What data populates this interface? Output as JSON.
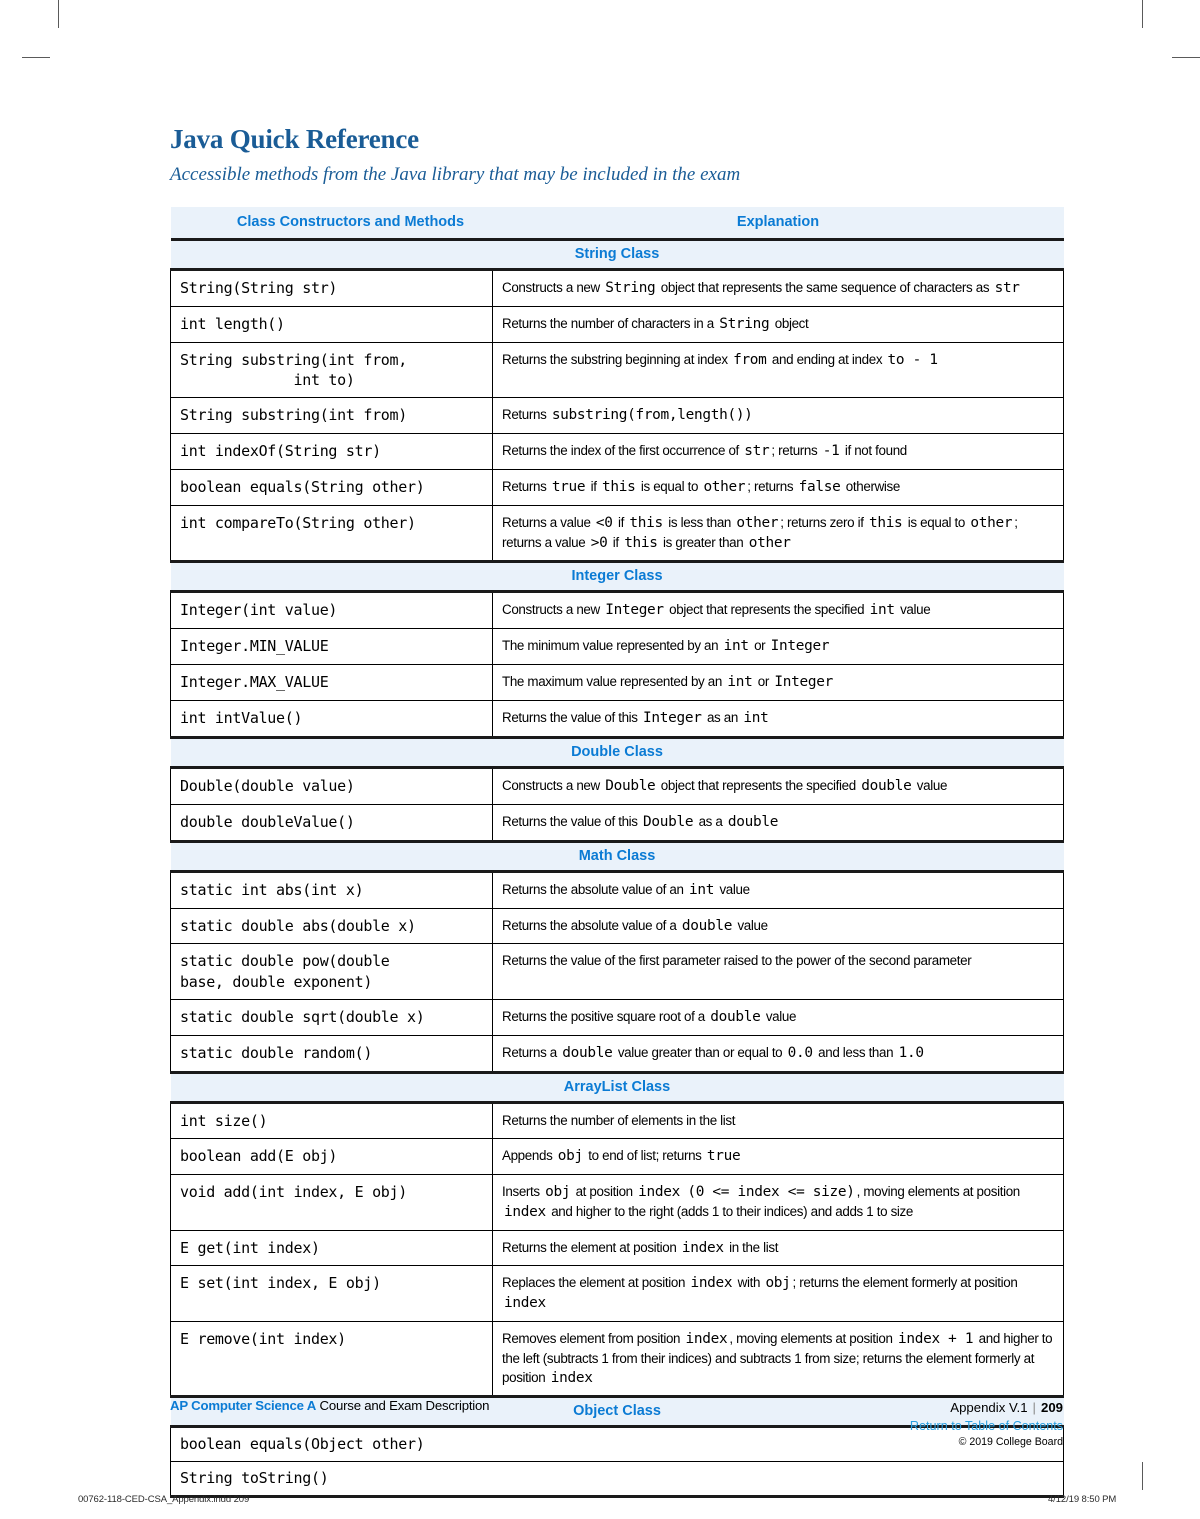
{
  "header": {
    "title": "Java Quick Reference",
    "subtitle": "Accessible methods from the Java library that may be included in the exam"
  },
  "table": {
    "columns": {
      "signature": "Class Constructors and Methods",
      "explanation": "Explanation"
    },
    "sections": [
      {
        "name": "String Class",
        "rows": [
          {
            "signature": "String(String str)",
            "explanation_parts": [
              {
                "t": "Constructs a new ",
                "code": false
              },
              {
                "t": "String",
                "code": true
              },
              {
                "t": " object that represents the same sequence of characters as ",
                "code": false
              },
              {
                "t": "str",
                "code": true
              }
            ]
          },
          {
            "signature": "int length()",
            "explanation_parts": [
              {
                "t": "Returns the number of characters in a ",
                "code": false
              },
              {
                "t": "String",
                "code": true
              },
              {
                "t": " object",
                "code": false
              }
            ]
          },
          {
            "signature": "String substring(int from,\n             int to)",
            "explanation_parts": [
              {
                "t": "Returns the substring beginning at index ",
                "code": false
              },
              {
                "t": "from",
                "code": true
              },
              {
                "t": " and ending at index ",
                "code": false
              },
              {
                "t": "to - 1",
                "code": true
              }
            ]
          },
          {
            "signature": "String substring(int from)",
            "explanation_parts": [
              {
                "t": "Returns ",
                "code": false
              },
              {
                "t": "substring(from,length())",
                "code": true
              }
            ]
          },
          {
            "signature": "int indexOf(String str)",
            "explanation_parts": [
              {
                "t": "Returns the index of the first occurrence of ",
                "code": false
              },
              {
                "t": "str",
                "code": true
              },
              {
                "t": "; returns ",
                "code": false
              },
              {
                "t": "-1",
                "code": true
              },
              {
                "t": " if not found",
                "code": false
              }
            ]
          },
          {
            "signature": "boolean equals(String other)",
            "explanation_parts": [
              {
                "t": "Returns ",
                "code": false
              },
              {
                "t": "true",
                "code": true
              },
              {
                "t": " if ",
                "code": false
              },
              {
                "t": "this",
                "code": true
              },
              {
                "t": " is equal to ",
                "code": false
              },
              {
                "t": "other",
                "code": true
              },
              {
                "t": "; returns ",
                "code": false
              },
              {
                "t": "false",
                "code": true
              },
              {
                "t": " otherwise",
                "code": false
              }
            ]
          },
          {
            "signature": "int compareTo(String other)",
            "explanation_parts": [
              {
                "t": "Returns a value ",
                "code": false
              },
              {
                "t": "<0",
                "code": true
              },
              {
                "t": " if ",
                "code": false
              },
              {
                "t": "this",
                "code": true
              },
              {
                "t": " is less than ",
                "code": false
              },
              {
                "t": "other",
                "code": true
              },
              {
                "t": "; returns zero if ",
                "code": false
              },
              {
                "t": "this",
                "code": true
              },
              {
                "t": " is equal to ",
                "code": false
              },
              {
                "t": "other",
                "code": true
              },
              {
                "t": "; returns a value ",
                "code": false
              },
              {
                "t": ">0",
                "code": true
              },
              {
                "t": " if ",
                "code": false
              },
              {
                "t": "this",
                "code": true
              },
              {
                "t": " is greater than ",
                "code": false
              },
              {
                "t": "other",
                "code": true
              }
            ]
          }
        ]
      },
      {
        "name": "Integer Class",
        "rows": [
          {
            "signature": "Integer(int value)",
            "explanation_parts": [
              {
                "t": "Constructs a new ",
                "code": false
              },
              {
                "t": "Integer",
                "code": true
              },
              {
                "t": " object that represents the specified ",
                "code": false
              },
              {
                "t": "int",
                "code": true
              },
              {
                "t": " value",
                "code": false
              }
            ]
          },
          {
            "signature": "Integer.MIN_VALUE",
            "explanation_parts": [
              {
                "t": "The minimum value represented by an ",
                "code": false
              },
              {
                "t": "int",
                "code": true
              },
              {
                "t": " or ",
                "code": false
              },
              {
                "t": "Integer",
                "code": true
              }
            ]
          },
          {
            "signature": "Integer.MAX_VALUE",
            "explanation_parts": [
              {
                "t": "The maximum value represented by an ",
                "code": false
              },
              {
                "t": "int",
                "code": true
              },
              {
                "t": " or ",
                "code": false
              },
              {
                "t": "Integer",
                "code": true
              }
            ]
          },
          {
            "signature": "int intValue()",
            "explanation_parts": [
              {
                "t": "Returns the value of this ",
                "code": false
              },
              {
                "t": "Integer",
                "code": true
              },
              {
                "t": " as an ",
                "code": false
              },
              {
                "t": "int",
                "code": true
              }
            ]
          }
        ]
      },
      {
        "name": "Double Class",
        "rows": [
          {
            "signature": "Double(double value)",
            "explanation_parts": [
              {
                "t": "Constructs a new ",
                "code": false
              },
              {
                "t": "Double",
                "code": true
              },
              {
                "t": " object that represents the specified ",
                "code": false
              },
              {
                "t": "double",
                "code": true
              },
              {
                "t": " value",
                "code": false
              }
            ]
          },
          {
            "signature": "double doubleValue()",
            "explanation_parts": [
              {
                "t": "Returns the value of this ",
                "code": false
              },
              {
                "t": "Double",
                "code": true
              },
              {
                "t": " as a ",
                "code": false
              },
              {
                "t": "double",
                "code": true
              }
            ]
          }
        ]
      },
      {
        "name": "Math Class",
        "rows": [
          {
            "signature": "static int abs(int x)",
            "explanation_parts": [
              {
                "t": "Returns the absolute value of an ",
                "code": false
              },
              {
                "t": "int",
                "code": true
              },
              {
                "t": " value",
                "code": false
              }
            ]
          },
          {
            "signature": "static double abs(double x)",
            "explanation_parts": [
              {
                "t": "Returns the absolute value of a ",
                "code": false
              },
              {
                "t": "double",
                "code": true
              },
              {
                "t": " value",
                "code": false
              }
            ]
          },
          {
            "signature": "static double pow(double\nbase, double exponent)",
            "explanation_parts": [
              {
                "t": "Returns the value of the first parameter raised to the power of the second parameter",
                "code": false
              }
            ]
          },
          {
            "signature": "static double sqrt(double x)",
            "explanation_parts": [
              {
                "t": "Returns the positive square root of a ",
                "code": false
              },
              {
                "t": "double",
                "code": true
              },
              {
                "t": " value",
                "code": false
              }
            ]
          },
          {
            "signature": "static double random()",
            "explanation_parts": [
              {
                "t": "Returns a ",
                "code": false
              },
              {
                "t": "double",
                "code": true
              },
              {
                "t": " value greater than or equal to ",
                "code": false
              },
              {
                "t": "0.0",
                "code": true
              },
              {
                "t": " and less than ",
                "code": false
              },
              {
                "t": "1.0",
                "code": true
              }
            ]
          }
        ]
      },
      {
        "name": "ArrayList Class",
        "rows": [
          {
            "signature": "int size()",
            "explanation_parts": [
              {
                "t": "Returns the number of elements in the list",
                "code": false
              }
            ]
          },
          {
            "signature": "boolean add(E obj)",
            "explanation_parts": [
              {
                "t": "Appends ",
                "code": false
              },
              {
                "t": "obj",
                "code": true
              },
              {
                "t": " to end of list; returns ",
                "code": false
              },
              {
                "t": "true",
                "code": true
              }
            ]
          },
          {
            "signature": "void add(int index, E obj)",
            "explanation_parts": [
              {
                "t": "Inserts ",
                "code": false
              },
              {
                "t": "obj",
                "code": true
              },
              {
                "t": " at position ",
                "code": false
              },
              {
                "t": "index",
                "code": true
              },
              {
                "t": " ",
                "code": false
              },
              {
                "t": "(0 <= index <= size)",
                "code": true
              },
              {
                "t": ", moving elements at position ",
                "code": false
              },
              {
                "t": "index",
                "code": true
              },
              {
                "t": " and higher to the right (adds 1 to their indices) and adds 1 to size",
                "code": false
              }
            ]
          },
          {
            "signature": "E get(int index)",
            "explanation_parts": [
              {
                "t": "Returns the element at position ",
                "code": false
              },
              {
                "t": "index",
                "code": true
              },
              {
                "t": " in the list",
                "code": false
              }
            ]
          },
          {
            "signature": "E set(int index, E obj)",
            "explanation_parts": [
              {
                "t": "Replaces the element at position ",
                "code": false
              },
              {
                "t": "index",
                "code": true
              },
              {
                "t": " with ",
                "code": false
              },
              {
                "t": "obj",
                "code": true
              },
              {
                "t": "; returns the element formerly at position ",
                "code": false
              },
              {
                "t": "index",
                "code": true
              }
            ]
          },
          {
            "signature": "E remove(int index)",
            "explanation_parts": [
              {
                "t": "Removes element from position ",
                "code": false
              },
              {
                "t": "index",
                "code": true
              },
              {
                "t": ", moving elements at position ",
                "code": false
              },
              {
                "t": "index + 1",
                "code": true
              },
              {
                "t": " and higher to the left (subtracts 1 from their indices) and subtracts 1 from size; returns the element formerly at position ",
                "code": false
              },
              {
                "t": "index",
                "code": true
              }
            ]
          }
        ]
      },
      {
        "name": "Object Class",
        "span_rows": [
          {
            "signature": "boolean equals(Object other)"
          },
          {
            "signature": "String toString()"
          }
        ]
      }
    ]
  },
  "footer": {
    "brand": "AP Computer Science A",
    "doc_name": "Course and Exam Description",
    "appendix": "Appendix V.1",
    "separator": "|",
    "page_number": "209",
    "return_link": "Return to Table of Contents",
    "copyright": "© 2019 College Board"
  },
  "slug": {
    "left": "00762-118-CED-CSA_Appendix.indd   209",
    "right": "4/12/19   8:50 PM"
  },
  "colors": {
    "title_blue": "#1a5c96",
    "accent_blue": "#0b7bd4",
    "band_bg": "#eaf2fa",
    "link_blue": "#2a9fe0",
    "rule_black": "#1a1a1a"
  }
}
